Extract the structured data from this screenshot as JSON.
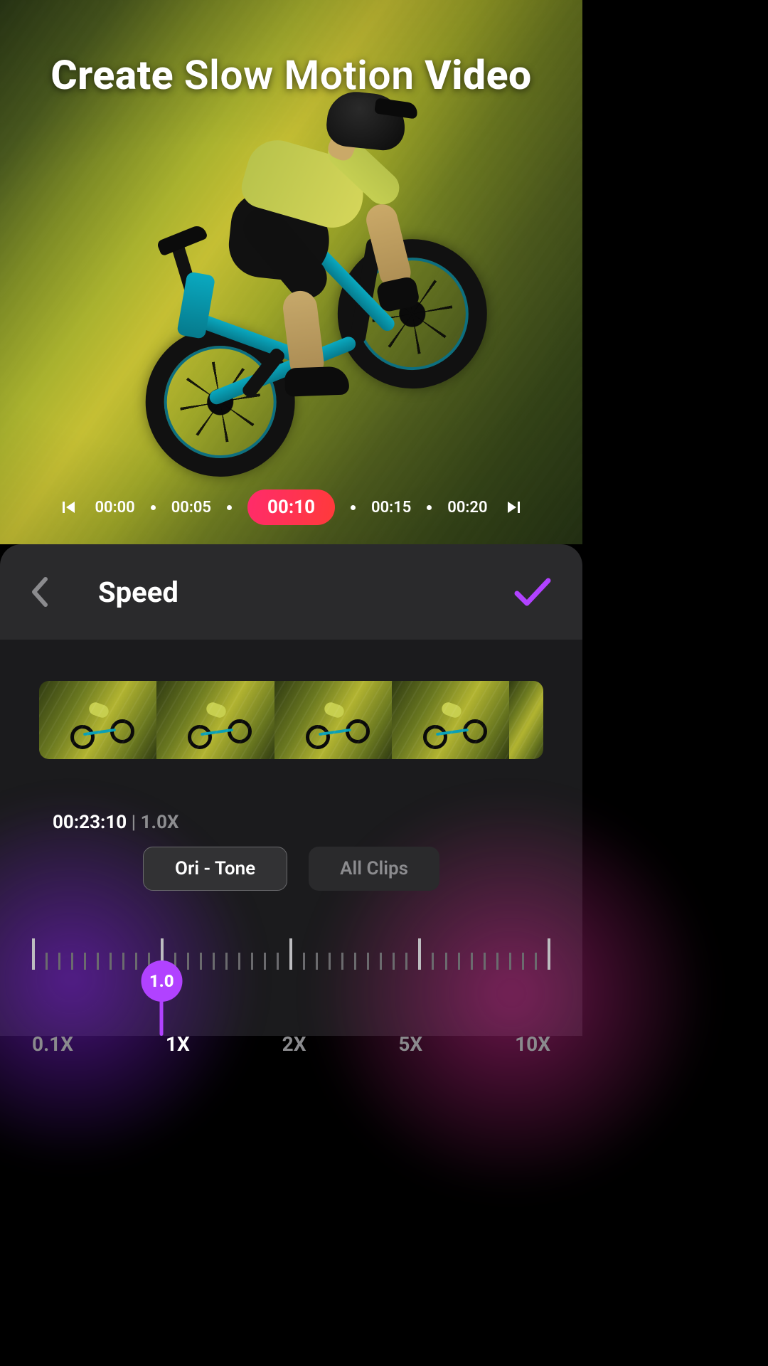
{
  "title_lead": "Create",
  "title_mid": " Slow Motion ",
  "title_tail": "Video",
  "timeline": {
    "marks": [
      "00:00",
      "00:05",
      "00:10",
      "00:15",
      "00:20"
    ],
    "active_index": 2
  },
  "panel": {
    "title": "Speed"
  },
  "clip": {
    "duration": "00:23:10",
    "separator": " | ",
    "rate": "1.0X"
  },
  "speed": {
    "value_label": "1.0",
    "labels": [
      "0.1X",
      "1X",
      "2X",
      "5X",
      "10X"
    ],
    "active_label_index": 1,
    "handle_fraction": 0.25
  },
  "buttons": {
    "ori_tone": "Ori - Tone",
    "all_clips": "All Clips"
  }
}
